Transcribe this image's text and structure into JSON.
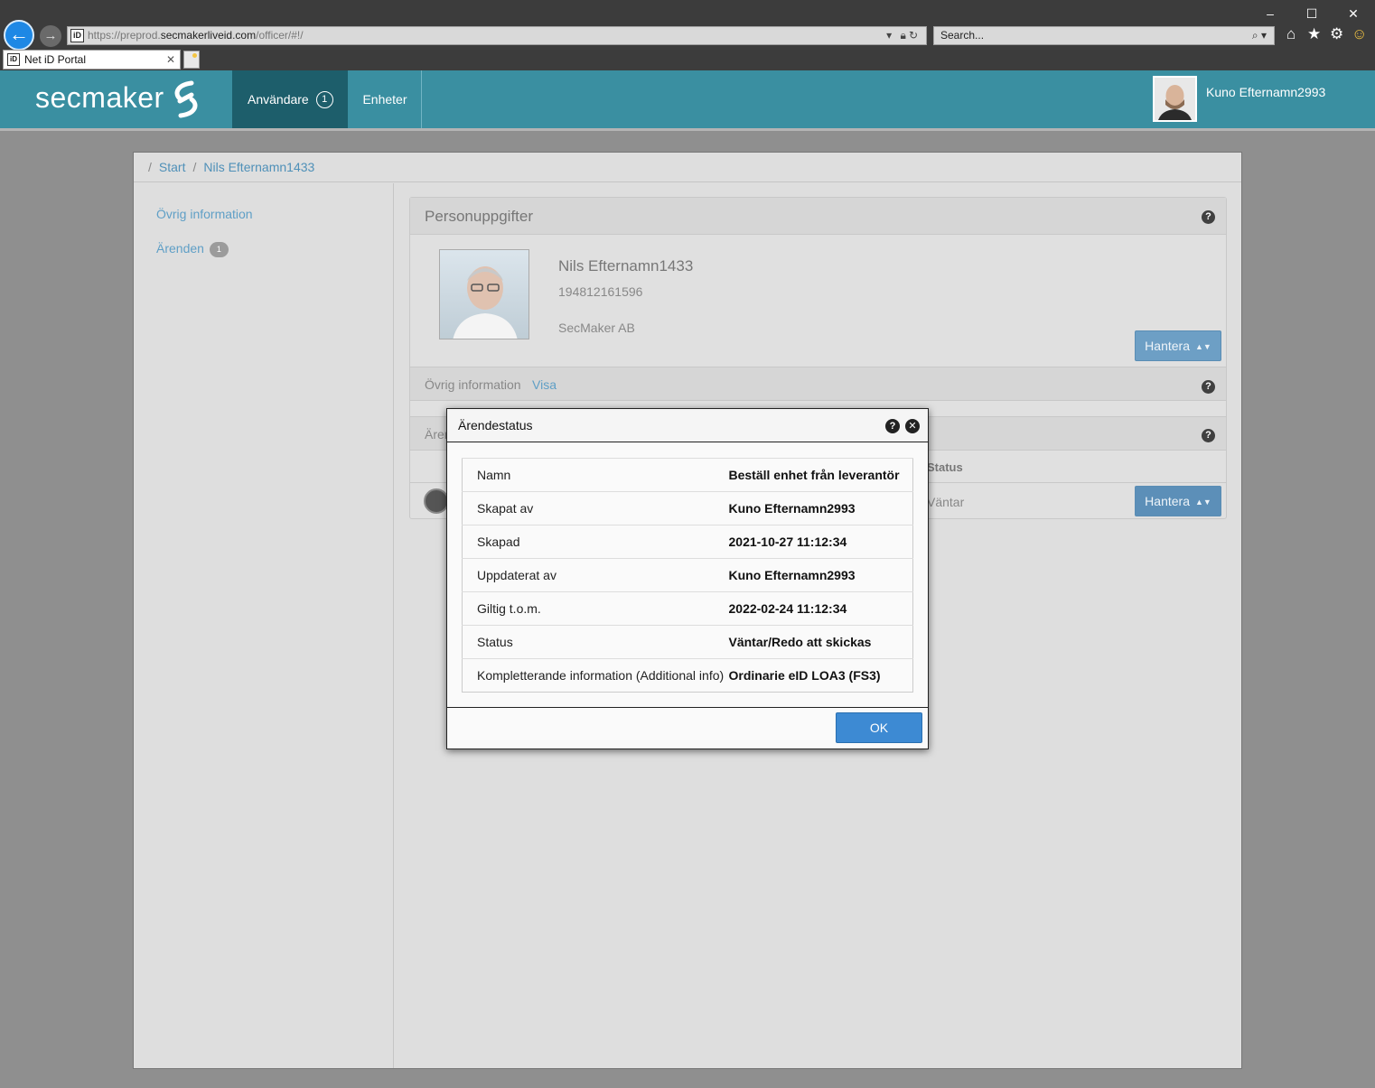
{
  "browser": {
    "url_scheme": "https://",
    "url_host_prefix": "preprod.",
    "url_host": "secmakerliveid.com",
    "url_path": "/officer/#!/",
    "search_placeholder": "Search...",
    "tab_title": "Net iD Portal",
    "favicon_text": "iD"
  },
  "header": {
    "logo": "secmaker",
    "nav": [
      {
        "label": "Användare",
        "badge": "1"
      },
      {
        "label": "Enheter"
      }
    ],
    "user_name": "Kuno Efternamn2993",
    "accent": "#3a8fa1"
  },
  "breadcrumb": {
    "root": "Start",
    "current": "Nils Efternamn1433"
  },
  "sidebar": {
    "items": [
      {
        "label": "Övrig information"
      },
      {
        "label": "Ärenden",
        "badge": "1"
      }
    ]
  },
  "person": {
    "section_title": "Personuppgifter",
    "name": "Nils Efternamn1433",
    "id_number": "194812161596",
    "organization": "SecMaker AB",
    "manage_label": "Hantera",
    "other_info_label": "Övrig information",
    "other_info_link": "Visa",
    "cases_label": "Ären",
    "status_col": "Status",
    "row_status": "Väntar"
  },
  "modal": {
    "title": "Ärendestatus",
    "rows": [
      {
        "key": "Namn",
        "value": "Beställ enhet från leverantör"
      },
      {
        "key": "Skapat av",
        "value": "Kuno Efternamn2993"
      },
      {
        "key": "Skapad",
        "value": "2021-10-27 11:12:34"
      },
      {
        "key": "Uppdaterat av",
        "value": "Kuno Efternamn2993"
      },
      {
        "key": "Giltig t.o.m.",
        "value": "2022-02-24 11:12:34"
      },
      {
        "key": "Status",
        "value": "Väntar/Redo att skickas"
      },
      {
        "key": "Kompletterande information (Additional info)",
        "value": "Ordinarie eID LOA3 (FS3)"
      }
    ],
    "ok_label": "OK"
  }
}
